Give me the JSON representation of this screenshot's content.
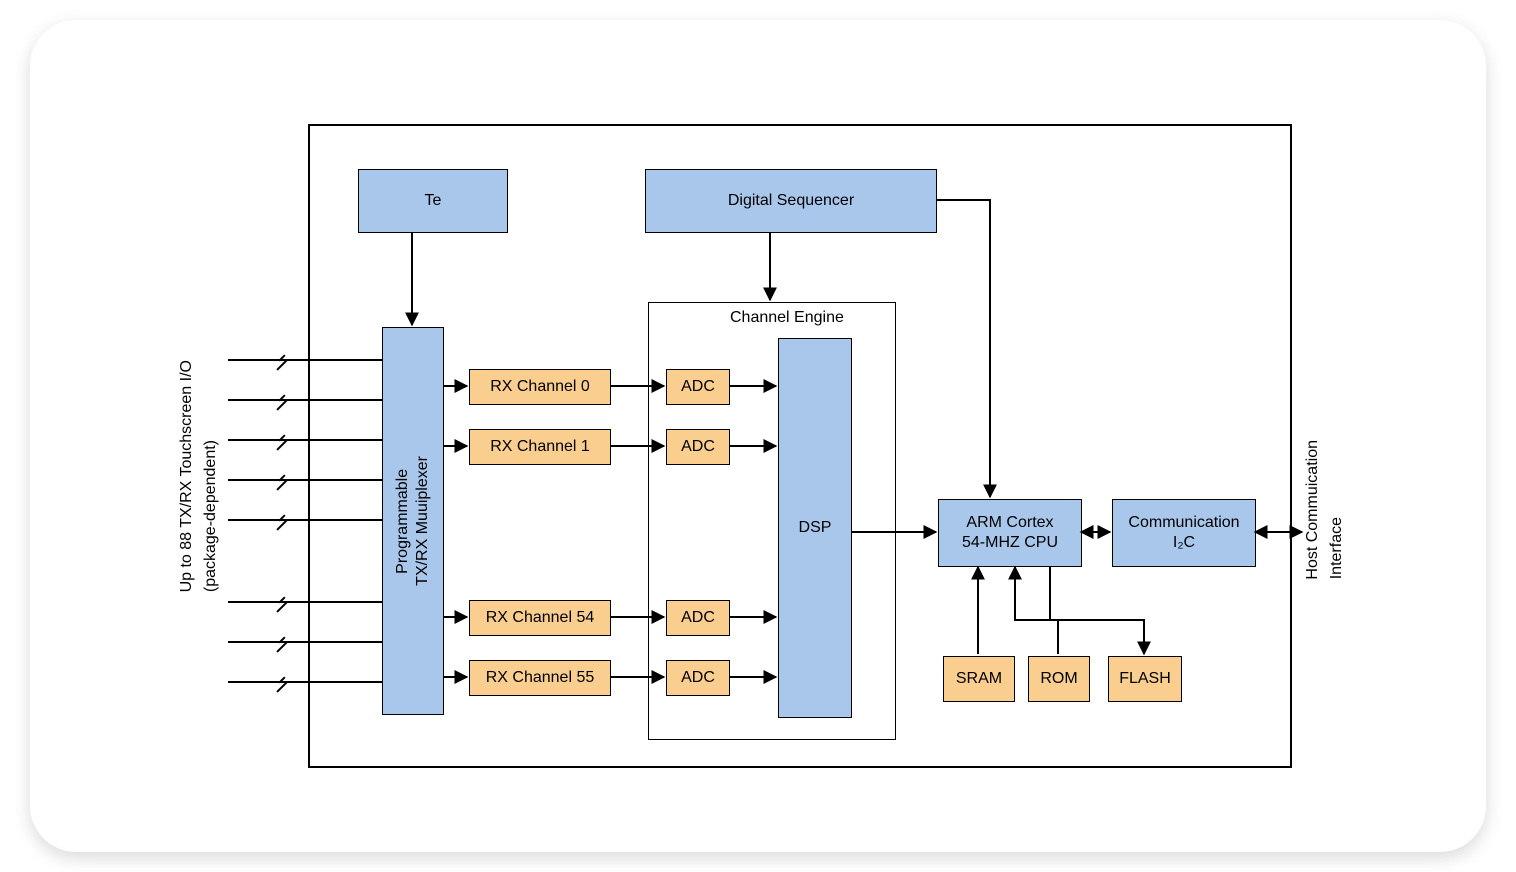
{
  "left_label_l1": "Up to 88 TX/RX Touchscreen I/O",
  "left_label_l2": "(package-dependent)",
  "right_label_l1": "Host Commuication",
  "right_label_l2": "Interface",
  "boxes": {
    "te": "Te",
    "seq": "Digital Sequencer",
    "mux_l1": "Programmable",
    "mux_l2": "TX/RX Muuiplexer",
    "rx0": "RX Channel 0",
    "rx1": "RX Channel 1",
    "rx54": "RX Channel 54",
    "rx55": "RX Channel 55",
    "adc": "ADC",
    "dsp": "DSP",
    "cpu_l1": "ARM Cortex",
    "cpu_l2": "54-MHZ CPU",
    "comm_l1": "Communication",
    "comm_l2": "I₂C",
    "sram": "SRAM",
    "rom": "ROM",
    "flash": "FLASH"
  },
  "ce_label": "Channel Engine"
}
